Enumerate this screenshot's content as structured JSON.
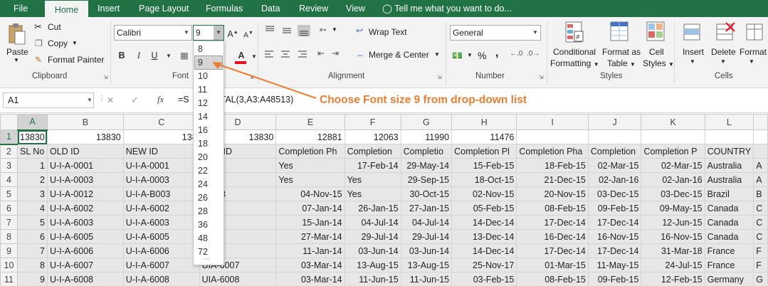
{
  "tabs": [
    "File",
    "Home",
    "Insert",
    "Page Layout",
    "Formulas",
    "Data",
    "Review",
    "View"
  ],
  "tell_me": "Tell me what you want to do...",
  "clipboard": {
    "paste": "Paste",
    "cut": "Cut",
    "copy": "Copy",
    "format_painter": "Format Painter",
    "label": "Clipboard"
  },
  "font": {
    "name": "Calibri",
    "size": "9",
    "label": "Font",
    "bold": "B",
    "italic": "I",
    "underline": "U"
  },
  "alignment": {
    "wrap_text": "Wrap Text",
    "merge_center": "Merge & Center",
    "label": "Alignment"
  },
  "number": {
    "format": "General",
    "percent": "%",
    "comma": ",",
    "label": "Number"
  },
  "styles": {
    "conditional_formatting": [
      "Conditional",
      "Formatting"
    ],
    "format_as_table": [
      "Format as",
      "Table"
    ],
    "cell_styles": [
      "Cell",
      "Styles"
    ],
    "label": "Styles"
  },
  "cells": {
    "insert": "Insert",
    "delete": "Delete",
    "format": "Format",
    "label": "Cells"
  },
  "formula_bar": {
    "name_box": "A1",
    "fx": "fx",
    "formula_left": "=S",
    "formula_right": "TAL(3,A3:A48513)"
  },
  "font_size_options": [
    "8",
    "9",
    "10",
    "11",
    "12",
    "14",
    "16",
    "18",
    "20",
    "22",
    "24",
    "26",
    "28",
    "36",
    "48",
    "72"
  ],
  "selected_font_size": "9",
  "annotation": "Choose Font size 9 from drop-down list",
  "columns": [
    "A",
    "B",
    "C",
    "D",
    "E",
    "F",
    "G",
    "H",
    "I",
    "J",
    "K",
    "L"
  ],
  "rows": [
    {
      "n": "1",
      "cells": [
        "13830",
        "13830",
        "138",
        "13830",
        "12881",
        "12063",
        "11990",
        "11476",
        "",
        "",
        "",
        ""
      ]
    },
    {
      "n": "2",
      "cells": [
        "SL No",
        "OLD ID",
        "NEW ID",
        "HER ID",
        "Completion Ph",
        "Completion",
        "Completio",
        "Completion Pl",
        "Completion Pha",
        "Completion",
        "Completion P",
        "COUNTRY"
      ]
    },
    {
      "n": "3",
      "cells": [
        "1",
        "U-I-A-0001",
        "U-I-A-0001",
        "-0001",
        "Yes",
        "17-Feb-14",
        "29-May-14",
        "15-Feb-15",
        "18-Feb-15",
        "02-Mar-15",
        "02-Mar-15",
        "Australia"
      ]
    },
    {
      "n": "4",
      "cells": [
        "2",
        "U-I-A-0003",
        "U-I-A-0003",
        "-0003",
        "Yes",
        "Yes",
        "29-Sep-15",
        "18-Oct-15",
        "21-Dec-15",
        "02-Jan-16",
        "02-Jan-16",
        "Australia"
      ]
    },
    {
      "n": "5",
      "cells": [
        "3",
        "U-I-A-0012",
        "U-I-A-B003",
        "-B003",
        "04-Nov-15",
        "Yes",
        "30-Oct-15",
        "02-Nov-15",
        "20-Nov-15",
        "03-Dec-15",
        "03-Dec-15",
        "Brazil"
      ]
    },
    {
      "n": "6",
      "cells": [
        "4",
        "U-I-A-6002",
        "U-I-A-6002",
        "-6002",
        "07-Jan-14",
        "26-Jan-15",
        "27-Jan-15",
        "05-Feb-15",
        "08-Feb-15",
        "09-Feb-15",
        "09-May-15",
        "Canada"
      ]
    },
    {
      "n": "7",
      "cells": [
        "5",
        "U-I-A-6003",
        "U-I-A-6003",
        "-6003",
        "15-Jan-14",
        "04-Jul-14",
        "04-Jul-14",
        "14-Dec-14",
        "17-Dec-14",
        "17-Dec-14",
        "12-Jun-15",
        "Canada"
      ]
    },
    {
      "n": "8",
      "cells": [
        "6",
        "U-I-A-6005",
        "U-I-A-6005",
        "-6005",
        "27-Mar-14",
        "29-Jul-14",
        "29-Jul-14",
        "13-Dec-14",
        "16-Dec-14",
        "16-Nov-15",
        "16-Nov-15",
        "Canada"
      ]
    },
    {
      "n": "9",
      "cells": [
        "7",
        "U-I-A-6006",
        "U-I-A-6006",
        "-6006",
        "11-Jan-14",
        "03-Jun-14",
        "03-Jun-14",
        "14-Dec-14",
        "17-Dec-14",
        "17-Dec-14",
        "31-Mar-18",
        "France"
      ]
    },
    {
      "n": "10",
      "cells": [
        "8",
        "U-I-A-6007",
        "U-I-A-6007",
        "UIA-6007",
        "03-Mar-14",
        "13-Aug-15",
        "13-Aug-15",
        "25-Nov-17",
        "01-Mar-15",
        "11-May-15",
        "24-Jul-15",
        "France"
      ]
    },
    {
      "n": "11",
      "cells": [
        "9",
        "U-I-A-6008",
        "U-I-A-6008",
        "UIA-6008",
        "03-Mar-14",
        "11-Jun-15",
        "11-Jun-15",
        "03-Feb-15",
        "08-Feb-15",
        "09-Feb-15",
        "12-Feb-15",
        "Germany"
      ]
    }
  ],
  "extra_col": [
    "",
    "",
    "A",
    "A",
    "B",
    "C",
    "C",
    "C",
    "F",
    "F",
    "G"
  ],
  "colors": {
    "accent": "#217346",
    "annotation": "#ed7d31"
  }
}
